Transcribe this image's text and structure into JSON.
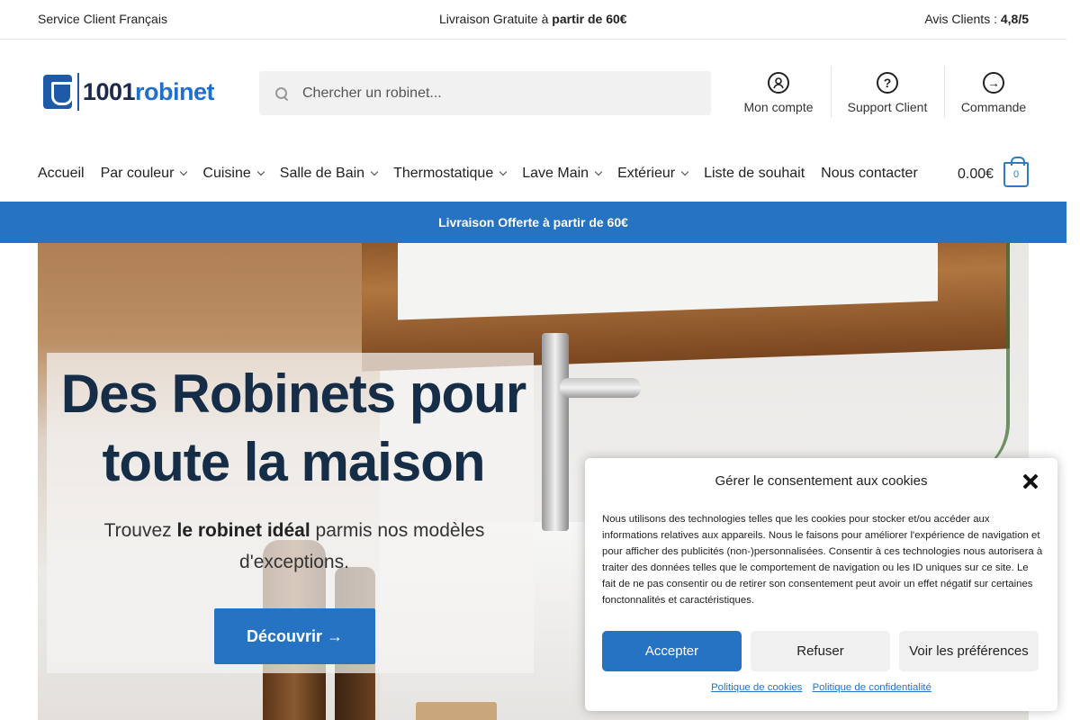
{
  "topbar": {
    "left": "Service Client Français",
    "center_prefix": "Livraison Gratuite à ",
    "center_bold": "partir de 60€",
    "right_prefix": "Avis Clients : ",
    "right_bold": "4,8/5"
  },
  "logo": {
    "text_dark": "1001",
    "text_blue": "robinet"
  },
  "search": {
    "placeholder": "Chercher un robinet..."
  },
  "header_links": [
    {
      "label": "Mon compte",
      "icon": "user-icon"
    },
    {
      "label": "Support Client",
      "icon": "question-icon"
    },
    {
      "label": "Commande",
      "icon": "arrow-right-icon"
    }
  ],
  "nav": {
    "items": [
      {
        "label": "Accueil",
        "dropdown": false
      },
      {
        "label": "Par couleur",
        "dropdown": true
      },
      {
        "label": "Cuisine",
        "dropdown": true
      },
      {
        "label": "Salle de Bain",
        "dropdown": true
      },
      {
        "label": "Thermostatique",
        "dropdown": true
      },
      {
        "label": "Lave Main",
        "dropdown": true
      },
      {
        "label": "Extérieur",
        "dropdown": true
      },
      {
        "label": "Liste de souhait",
        "dropdown": false
      },
      {
        "label": "Nous contacter",
        "dropdown": false
      }
    ],
    "cart_total": "0.00€",
    "cart_count": "0"
  },
  "promo_bar": "Livraison Offerte à partir de 60€",
  "hero": {
    "title": "Des Robinets pour toute la maison",
    "subtitle_prefix": "Trouvez ",
    "subtitle_bold": "le robinet idéal",
    "subtitle_suffix": " parmis nos modèles d'exceptions.",
    "cta": "Découvrir →"
  },
  "cookie": {
    "title": "Gérer le consentement aux cookies",
    "text": "Nous utilisons des technologies telles que les cookies pour stocker et/ou accéder aux informations relatives aux appareils. Nous le faisons pour améliorer l'expérience de navigation et pour afficher des publicités (non-)personnalisées. Consentir à ces technologies nous autorisera à traiter des données telles que le comportement de navigation ou les ID uniques sur ce site. Le fait de ne pas consentir ou de retirer son consentement peut avoir un effet négatif sur certaines fonctonnalités et caractéristiques.",
    "accept": "Accepter",
    "refuse": "Refuser",
    "prefs": "Voir les préférences",
    "link_cookies": "Politique de cookies",
    "link_privacy": "Politique de confidentialité"
  },
  "colors": {
    "brand_blue": "#2673c4",
    "hero_title": "#162d48"
  }
}
